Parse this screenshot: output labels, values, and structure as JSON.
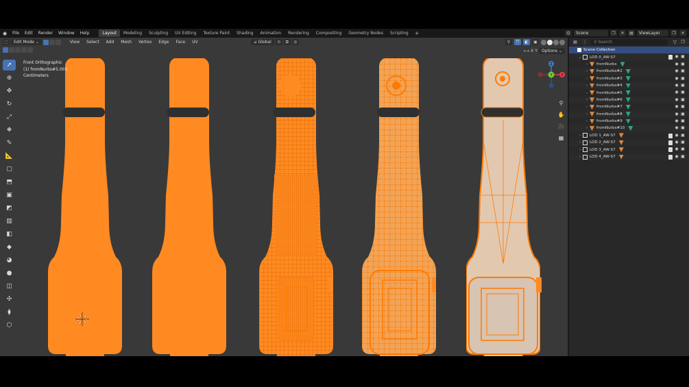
{
  "topbar": {
    "menu": [
      "File",
      "Edit",
      "Render",
      "Window",
      "Help"
    ],
    "workspaces": [
      "Layout",
      "Modeling",
      "Sculpting",
      "UV Editing",
      "Texture Paint",
      "Shading",
      "Animation",
      "Rendering",
      "Compositing",
      "Geometry Nodes",
      "Scripting"
    ],
    "active_workspace": "Layout",
    "add_symbol": "+",
    "scene": "Scene",
    "view_layer": "ViewLayer"
  },
  "viewport": {
    "mode": "Edit Mode",
    "menu": [
      "View",
      "Select",
      "Add",
      "Mesh",
      "Vertex",
      "Edge",
      "Face",
      "UV"
    ],
    "transform_orientation": "Global",
    "axes": [
      "X",
      "Y",
      "Z"
    ],
    "options_label": "Options",
    "info_line1": "Front Orthographic",
    "info_line2": "(1) fromNurbs#5.003",
    "info_line3": "Centimeters",
    "gizmo": {
      "x": "X",
      "y": "Y",
      "z": "Z"
    },
    "mesh_color": "#ff8a21",
    "wire_color": "#ff7a00",
    "background": "#393939"
  },
  "outliner": {
    "search_placeholder": "Search",
    "scene_collection": "Scene Collection",
    "rows": [
      {
        "label": "LOD 0_AW-S7",
        "level": 1,
        "type": "collection",
        "expanded": true
      },
      {
        "label": "fromNurbs",
        "level": 2,
        "type": "mesh"
      },
      {
        "label": "fromNurbs#2",
        "level": 2,
        "type": "mesh"
      },
      {
        "label": "fromNurbs#3",
        "level": 2,
        "type": "mesh"
      },
      {
        "label": "fromNurbs#4",
        "level": 2,
        "type": "mesh"
      },
      {
        "label": "fromNurbs#5",
        "level": 2,
        "type": "mesh"
      },
      {
        "label": "fromNurbs#6",
        "level": 2,
        "type": "mesh"
      },
      {
        "label": "fromNurbs#7",
        "level": 2,
        "type": "mesh"
      },
      {
        "label": "fromNurbs#8",
        "level": 2,
        "type": "mesh"
      },
      {
        "label": "fromNurbs#9",
        "level": 2,
        "type": "mesh"
      },
      {
        "label": "fromNurbs#10",
        "level": 2,
        "type": "mesh"
      },
      {
        "label": "LOD 1_AW-S7",
        "level": 1,
        "type": "collection",
        "expanded": false
      },
      {
        "label": "LOD 2_AW-S7",
        "level": 1,
        "type": "collection",
        "expanded": false
      },
      {
        "label": "LOD 3_AW-S7",
        "level": 1,
        "type": "collection",
        "expanded": false
      },
      {
        "label": "LOD 4_AW-S7",
        "level": 1,
        "type": "collection",
        "expanded": false
      }
    ]
  }
}
